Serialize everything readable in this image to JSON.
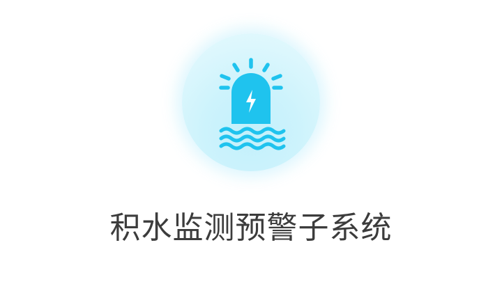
{
  "app": {
    "title": "积水监测预警子系统",
    "icon": "alarm-beacon-flood-icon"
  },
  "colors": {
    "accent": "#1fc3ee",
    "icon_glyph": "#ffffff",
    "badge_background": "#d4f5fc",
    "title_text": "#3c3c3c",
    "page_background": "#ffffff"
  }
}
